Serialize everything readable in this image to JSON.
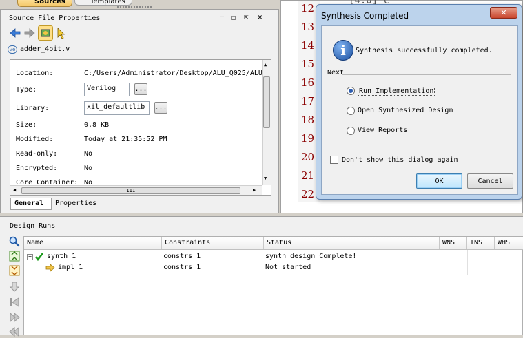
{
  "top_tabs": {
    "sources": "Sources",
    "templates": "Templates"
  },
  "props_panel": {
    "title": "Source File Properties",
    "title_buttons": [
      "—",
      "☐",
      "⇱",
      "✕"
    ],
    "file_name": "adder_4bit.v",
    "fields": [
      {
        "label": "Location:",
        "value": "C:/Users/Administrator/Desktop/ALU_Q025/ALU"
      },
      {
        "label": "Type:",
        "value": "Verilog"
      },
      {
        "label": "Library:",
        "value": "xil_defaultlib"
      },
      {
        "label": "Size:",
        "value": "0.8 KB"
      },
      {
        "label": "Modified:",
        "value": "Today at 21:35:52 PM"
      },
      {
        "label": "Read-only:",
        "value": "No"
      },
      {
        "label": "Encrypted:",
        "value": "No"
      },
      {
        "label": "Core Container:",
        "value": "No"
      }
    ],
    "browse_label": "...",
    "scroll_grip": "III",
    "tabs": [
      "General",
      "Properties"
    ]
  },
  "editor": {
    "line_numbers": [
      "12",
      "13",
      "14",
      "15",
      "16",
      "17",
      "18",
      "19",
      "20",
      "21",
      "22"
    ],
    "code_fragment": "[4:0]    c"
  },
  "dialog": {
    "title": "Synthesis Completed",
    "message": "Synthesis successfully completed.",
    "section": "Next",
    "options": [
      "Run Implementation",
      "Open Synthesized Design",
      "View Reports"
    ],
    "selected_option": 0,
    "dont_show": "Don't show this dialog again",
    "ok": "OK",
    "cancel": "Cancel",
    "close": "✕"
  },
  "design_runs": {
    "title": "Design Runs",
    "columns": [
      "Name",
      "Constraints",
      "Status",
      "WNS",
      "TNS",
      "WHS"
    ],
    "rows": [
      {
        "name": "synth_1",
        "constraints": "constrs_1",
        "status": "synth_design Complete!"
      },
      {
        "name": "impl_1",
        "constraints": "constrs_1",
        "status": "Not started"
      }
    ]
  },
  "colors": {
    "accent": "#2d5db0",
    "line_number": "#8b0000",
    "dialog_frame": "#5a7fae"
  }
}
